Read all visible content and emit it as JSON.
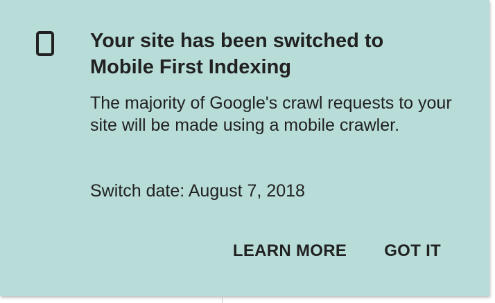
{
  "dialog": {
    "icon": "smartphone-icon",
    "title": "Your site has been switched to Mobile First Indexing",
    "body": "The majority of Google's crawl requests to your site will be made using a mobile crawler.",
    "switch_date": "Switch date: August 7, 2018",
    "actions": {
      "learn_more": "LEARN MORE",
      "got_it": "GOT IT"
    }
  },
  "colors": {
    "card_background": "#b8ddd8",
    "text": "#212121"
  }
}
